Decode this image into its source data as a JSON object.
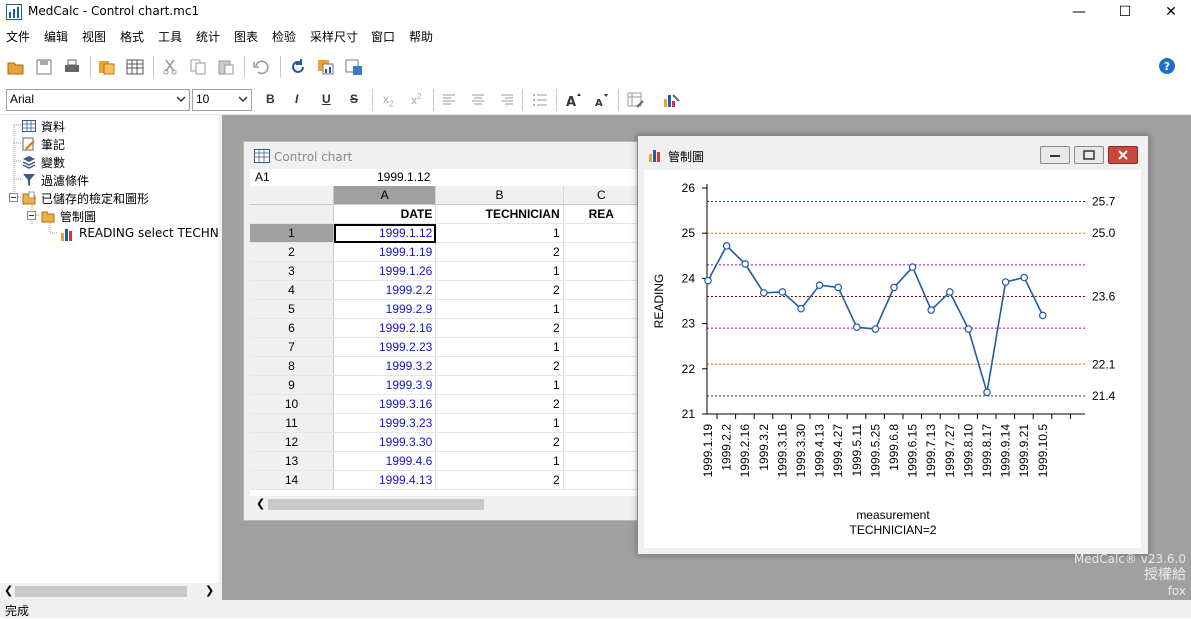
{
  "window": {
    "title": "MedCalc - Control chart.mc1"
  },
  "menu": [
    "文件",
    "编辑",
    "视图",
    "格式",
    "工具",
    "统计",
    "图表",
    "检验",
    "采样尺寸",
    "窗口",
    "帮助"
  ],
  "toolbar": {
    "font_name": "Arial",
    "font_size": "10"
  },
  "tree": {
    "items": [
      "資料",
      "筆記",
      "變數",
      "過濾條件",
      "已儲存的檢定和圖形",
      "管制圖",
      "READING select TECHNIC"
    ]
  },
  "sheet": {
    "title": "Control chart",
    "cell_ref": "A1",
    "cell_value": "1999.1.12",
    "col_headers": [
      "A",
      "B",
      "C"
    ],
    "col_names": [
      "DATE",
      "TECHNICIAN",
      "REA"
    ],
    "rows": [
      [
        "1",
        "1999.1.12",
        "1"
      ],
      [
        "2",
        "1999.1.19",
        "2"
      ],
      [
        "3",
        "1999.1.26",
        "1"
      ],
      [
        "4",
        "1999.2.2",
        "2"
      ],
      [
        "5",
        "1999.2.9",
        "1"
      ],
      [
        "6",
        "1999.2.16",
        "2"
      ],
      [
        "7",
        "1999.2.23",
        "1"
      ],
      [
        "8",
        "1999.3.2",
        "2"
      ],
      [
        "9",
        "1999.3.9",
        "1"
      ],
      [
        "10",
        "1999.3.16",
        "2"
      ],
      [
        "11",
        "1999.3.23",
        "1"
      ],
      [
        "12",
        "1999.3.30",
        "2"
      ],
      [
        "13",
        "1999.4.6",
        "1"
      ],
      [
        "14",
        "1999.4.13",
        "2"
      ]
    ]
  },
  "chart_window": {
    "title": "管制圖"
  },
  "chart_data": {
    "type": "line",
    "ylabel": "READING",
    "xlabel": "measurement",
    "subtitle": "TECHNICIAN=2",
    "ylim": [
      21,
      26
    ],
    "yticks": [
      "21",
      "22",
      "23",
      "24",
      "25",
      "26"
    ],
    "x": [
      "",
      "1999.1.19",
      "",
      "1999.2.2",
      "",
      "1999.2.16",
      "",
      "1999.3.2",
      "",
      "1999.3.16",
      "",
      "1999.3.30",
      "",
      "1999.4.13",
      "",
      "1999.4.27",
      "",
      "1999.5.11",
      "",
      "1999.5.25",
      "",
      "1999.6.8",
      "",
      "1999.6.15",
      "",
      "1999.7.13",
      "",
      "1999.7.27",
      "",
      "1999.8.10",
      "",
      "1999.8.17",
      "",
      "1999.9.14",
      "",
      "1999.9.21",
      "",
      "1999.10.5"
    ],
    "points": [
      {
        "x": 0,
        "y": 23.95
      },
      {
        "x": 1,
        "y": 24.72
      },
      {
        "x": 2,
        "y": 24.32
      },
      {
        "x": 3,
        "y": 23.68
      },
      {
        "x": 4,
        "y": 23.7
      },
      {
        "x": 5,
        "y": 23.33
      },
      {
        "x": 6,
        "y": 23.85
      },
      {
        "x": 7,
        "y": 23.8
      },
      {
        "x": 8,
        "y": 22.92
      },
      {
        "x": 9,
        "y": 22.88
      },
      {
        "x": 10,
        "y": 23.8
      },
      {
        "x": 11,
        "y": 24.25
      },
      {
        "x": 12,
        "y": 23.3
      },
      {
        "x": 13,
        "y": 23.7
      },
      {
        "x": 14,
        "y": 22.88
      },
      {
        "x": 15,
        "y": 21.48
      },
      {
        "x": 16,
        "y": 23.92
      },
      {
        "x": 17,
        "y": 24.02
      },
      {
        "x": 18,
        "y": 23.18
      }
    ],
    "x_label_indices": [
      0,
      1,
      2,
      3,
      4,
      5,
      6,
      7,
      8,
      9,
      10,
      11,
      12,
      13,
      14,
      15,
      16,
      17,
      18
    ],
    "x_labels": [
      "1999.1.19",
      "1999.2.2",
      "1999.2.16",
      "1999.3.2",
      "1999.3.16",
      "1999.3.30",
      "1999.4.13",
      "1999.4.27",
      "1999.5.11",
      "1999.5.25",
      "1999.6.8",
      "1999.6.15",
      "1999.7.13",
      "1999.7.27",
      "1999.8.10",
      "1999.8.17",
      "1999.9.14",
      "1999.9.21",
      "1999.10.5"
    ],
    "control_lines": [
      {
        "value": 25.7,
        "label": "25.7",
        "color": "#006400"
      },
      {
        "value": 25.0,
        "label": "25.0",
        "color": "#e07000"
      },
      {
        "value": 24.3,
        "label": "",
        "color": "#b000b0"
      },
      {
        "value": 23.6,
        "label": "23.6",
        "color": "#8b0000"
      },
      {
        "value": 22.9,
        "label": "",
        "color": "#b000b0"
      },
      {
        "value": 22.1,
        "label": "22.1",
        "color": "#e07000"
      },
      {
        "value": 21.4,
        "label": "21.4",
        "color": "#006400"
      }
    ],
    "line_color": "#1f5aa6"
  },
  "status": {
    "text": "完成"
  },
  "watermark": {
    "line1": "MedCalc® v23.6.0",
    "line2": "授權給",
    "line3": "fox"
  }
}
